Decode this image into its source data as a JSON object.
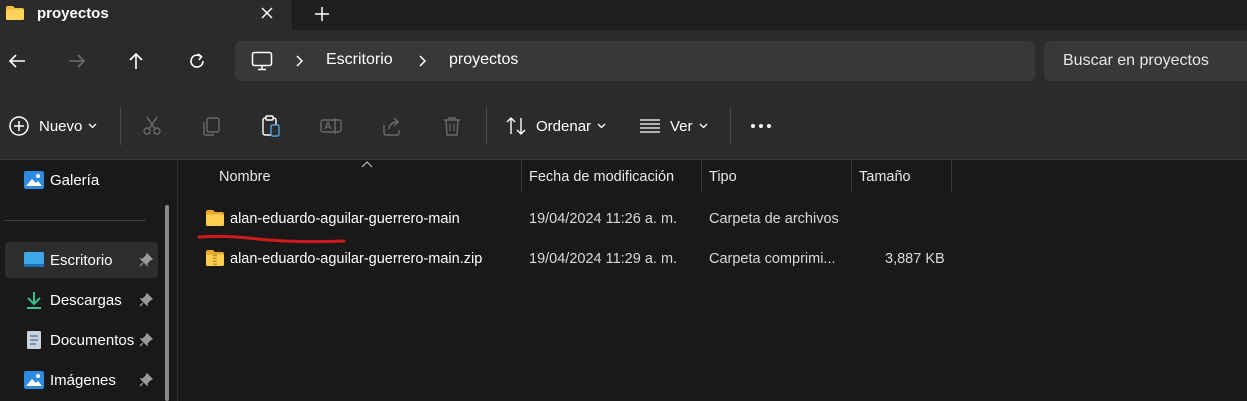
{
  "tab": {
    "title": "proyectos"
  },
  "address": {
    "crumbs": [
      "Escritorio",
      "proyectos"
    ]
  },
  "search": {
    "placeholder": "Buscar en proyectos"
  },
  "toolbar": {
    "new_label": "Nuevo",
    "sort_label": "Ordenar",
    "view_label": "Ver"
  },
  "sidebar": {
    "items": [
      {
        "label": "Galería",
        "icon": "gallery-icon",
        "pinned": false
      },
      {
        "label": "Escritorio",
        "icon": "desktop-icon",
        "pinned": true,
        "active": true
      },
      {
        "label": "Descargas",
        "icon": "download-icon",
        "pinned": true
      },
      {
        "label": "Documentos",
        "icon": "document-icon",
        "pinned": true
      },
      {
        "label": "Imágenes",
        "icon": "image-icon",
        "pinned": true
      }
    ]
  },
  "columns": [
    "Nombre",
    "Fecha de modificación",
    "Tipo",
    "Tamaño"
  ],
  "files": [
    {
      "name": "alan-eduardo-aguilar-guerrero-main",
      "modified": "19/04/2024 11:26 a. m.",
      "type": "Carpeta de archivos",
      "size": "",
      "icon": "folder-icon"
    },
    {
      "name": "alan-eduardo-aguilar-guerrero-main.zip",
      "modified": "19/04/2024 11:29 a. m.",
      "type": "Carpeta comprimi...",
      "size": "3,887 KB",
      "icon": "zip-folder-icon"
    }
  ],
  "colors": {
    "accent_folder": "#f4c13e",
    "annotation": "#d11a1a",
    "background": "#191919"
  }
}
